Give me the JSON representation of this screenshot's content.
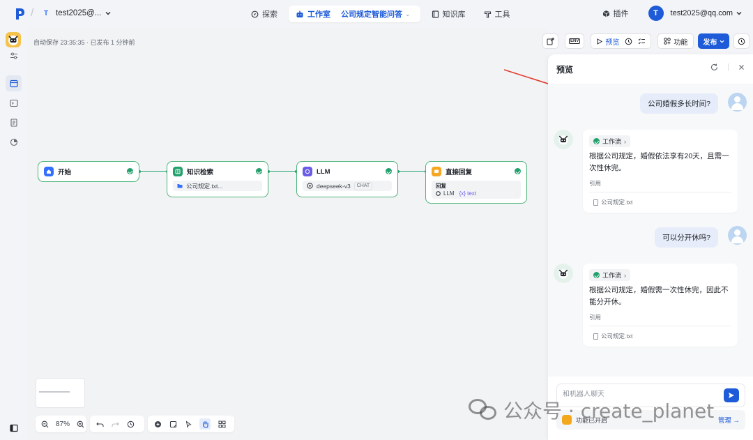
{
  "topbar": {
    "workspace_initial": "T",
    "workspace_name": "test2025@...",
    "nav": [
      {
        "label": "探索"
      },
      {
        "label": "工作室"
      },
      {
        "label": "知识库"
      },
      {
        "label": "工具"
      }
    ],
    "current_app": "公司规定智能问答",
    "plugin_label": "插件",
    "user_initial": "T",
    "user_email": "test2025@qq.com"
  },
  "canvas": {
    "autosave": "自动保存 23:35:35 · 已发布 1 分钟前",
    "toolbar": {
      "preview_label": "预览",
      "function_label": "功能",
      "publish_label": "发布",
      "env_label": "ENV"
    },
    "nodes": [
      {
        "title": "开始",
        "color": "#3370ff"
      },
      {
        "title": "知识检索",
        "color": "#22a06b",
        "sub": "公司规定.txt..."
      },
      {
        "title": "LLM",
        "color": "#6b5ce7",
        "sub": "deepseek-v3",
        "tag": "CHAT"
      },
      {
        "title": "直接回复",
        "color": "#f5a623",
        "sub_title": "回复",
        "sub": "LLM",
        "var": "{x} text"
      }
    ],
    "zoom": "87%"
  },
  "preview": {
    "title": "预览",
    "messages": [
      {
        "role": "user",
        "text": "公司婚假多长时间?"
      },
      {
        "role": "bot",
        "workflow": "工作流",
        "text": "根据公司规定，婚假依法享有20天，且需一次性休完。",
        "cite_label": "引用",
        "cite_file": "公司规定.txt"
      },
      {
        "role": "user",
        "text": "可以分开休吗?"
      },
      {
        "role": "bot",
        "workflow": "工作流",
        "text": "根据公司规定，婚假需一次性休完，因此不能分开休。",
        "cite_label": "引用",
        "cite_file": "公司规定.txt"
      }
    ],
    "input_placeholder": "和机器人聊天",
    "function_status": "功能已开启",
    "manage_label": "管理"
  },
  "watermark": "公众号 · create_planet",
  "colors": {
    "accent": "#1d5bd8",
    "success": "#22a06b"
  }
}
